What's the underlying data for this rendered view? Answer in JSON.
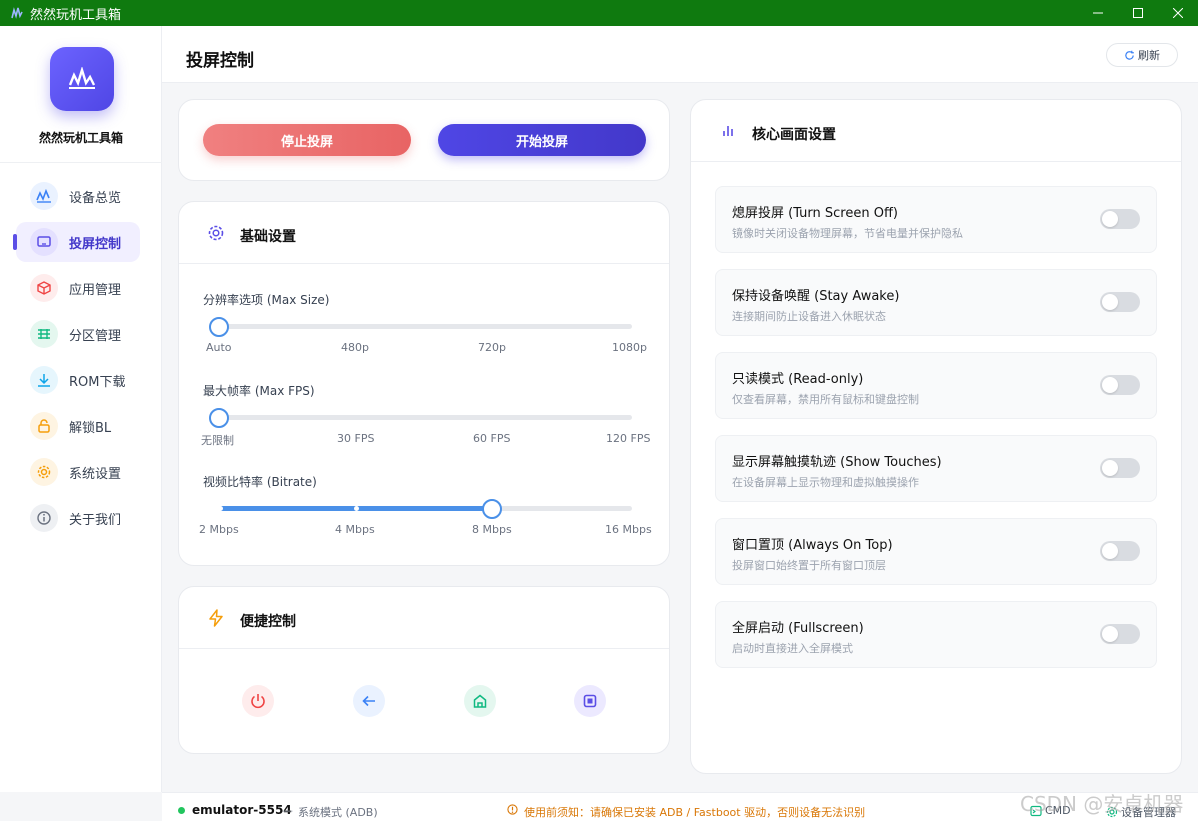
{
  "window": {
    "title": "然然玩机工具箱"
  },
  "sidebar": {
    "app_name": "然然玩机工具箱",
    "items": [
      {
        "label": "设备总览",
        "icon": "chart-icon",
        "color": "#3b82f6"
      },
      {
        "label": "投屏控制",
        "icon": "monitor-icon",
        "color": "#5b4ee6",
        "active": true
      },
      {
        "label": "应用管理",
        "icon": "cube-icon",
        "color": "#ef4444"
      },
      {
        "label": "分区管理",
        "icon": "partition-icon",
        "color": "#10b981"
      },
      {
        "label": "ROM下载",
        "icon": "download-icon",
        "color": "#0ea5e9"
      },
      {
        "label": "解锁BL",
        "icon": "lock-icon",
        "color": "#f59e0b"
      },
      {
        "label": "系统设置",
        "icon": "gear-icon",
        "color": "#f59e0b"
      },
      {
        "label": "关于我们",
        "icon": "info-icon",
        "color": "#6b7280"
      }
    ]
  },
  "header": {
    "title": "投屏控制",
    "refresh_label": "刷新"
  },
  "actions": {
    "stop_label": "停止投屏",
    "start_label": "开始投屏"
  },
  "basic": {
    "title": "基础设置",
    "resolution": {
      "label": "分辨率选项 (Max Size)",
      "ticks": [
        "Auto",
        "480p",
        "720p",
        "1080p"
      ],
      "value": "Auto"
    },
    "fps": {
      "label": "最大帧率 (Max FPS)",
      "ticks": [
        "无限制",
        "30 FPS",
        "60 FPS",
        "120 FPS"
      ],
      "value": "无限制"
    },
    "bitrate": {
      "label": "视频比特率 (Bitrate)",
      "ticks": [
        "2 Mbps",
        "4 Mbps",
        "8 Mbps",
        "16 Mbps"
      ],
      "value": "8 Mbps"
    }
  },
  "quick": {
    "title": "便捷控制",
    "buttons": [
      {
        "icon": "power-icon",
        "color": "#ef4444"
      },
      {
        "icon": "back-arrow-icon",
        "color": "#3b82f6"
      },
      {
        "icon": "home-icon",
        "color": "#10b981"
      },
      {
        "icon": "recent-apps-icon",
        "color": "#5b4ee6"
      }
    ]
  },
  "core": {
    "title": "核心画面设置",
    "settings": [
      {
        "title": "熄屏投屏 (Turn Screen Off)",
        "desc": "镜像时关闭设备物理屏幕，节省电量并保护隐私",
        "on": false
      },
      {
        "title": "保持设备唤醒 (Stay Awake)",
        "desc": "连接期间防止设备进入休眠状态",
        "on": false
      },
      {
        "title": "只读模式 (Read-only)",
        "desc": "仅查看屏幕，禁用所有鼠标和键盘控制",
        "on": false
      },
      {
        "title": "显示屏幕触摸轨迹 (Show Touches)",
        "desc": "在设备屏幕上显示物理和虚拟触摸操作",
        "on": false
      },
      {
        "title": "窗口置顶 (Always On Top)",
        "desc": "投屏窗口始终置于所有窗口顶层",
        "on": false
      },
      {
        "title": "全屏启动 (Fullscreen)",
        "desc": "启动时直接进入全屏模式",
        "on": false
      }
    ]
  },
  "status": {
    "device": "emulator-5554",
    "separator": "—",
    "mode": "系统模式 (ADB)",
    "notice": "使用前须知：请确保已安装 ADB / Fastboot 驱动，否则设备无法识别",
    "cmd_label": "CMD",
    "devmgr_label": "设备管理器"
  },
  "watermark": "CSDN @安卓机器"
}
